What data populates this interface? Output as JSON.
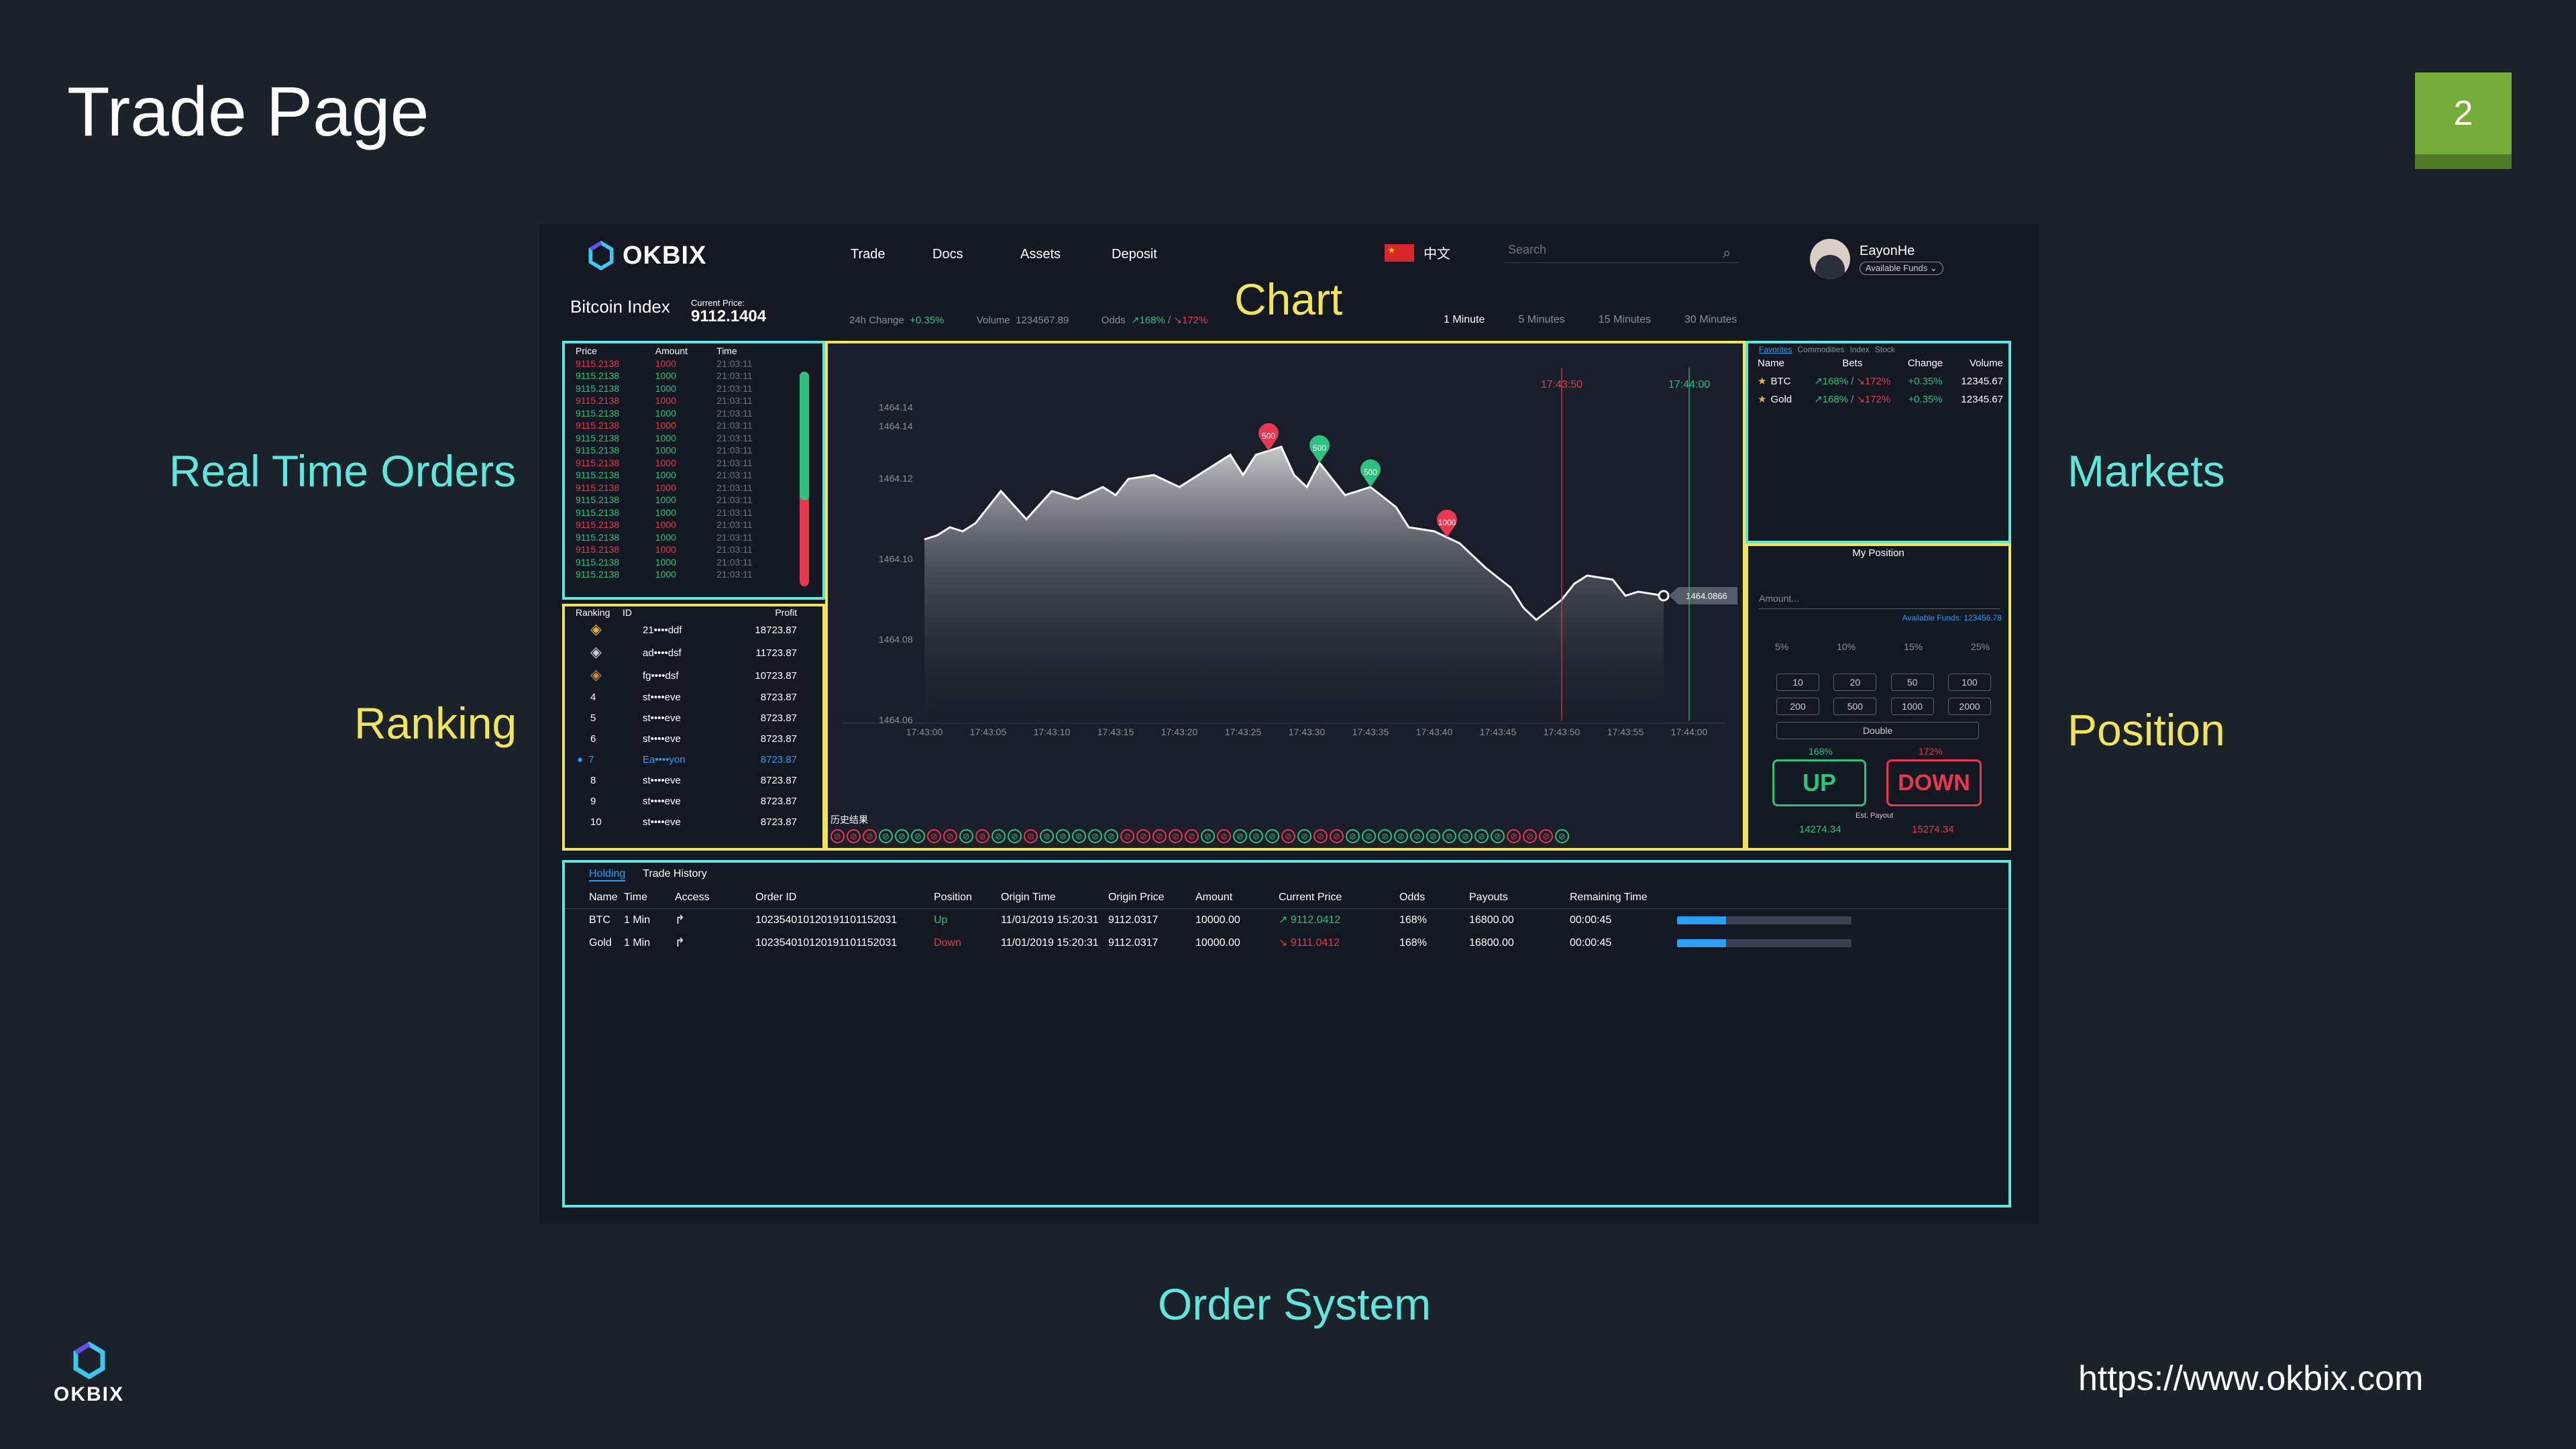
{
  "slide": {
    "title": "Trade Page",
    "page_number": "2",
    "url": "https://www.okbix.com",
    "logo_text": "OKBIX",
    "callouts": {
      "real_time_orders": "Real Time Orders",
      "ranking": "Ranking",
      "chart": "Chart",
      "markets": "Markets",
      "position": "Position",
      "order_system": "Order System"
    }
  },
  "app": {
    "logo": "OKBIX",
    "nav": [
      "Trade",
      "Docs",
      "Assets",
      "Deposit"
    ],
    "language": "中文",
    "search_placeholder": "Search",
    "user_name": "EayonHe",
    "funds_dropdown": "Available Funds",
    "index_name": "Bitcoin Index",
    "current_price_label": "Current Price:",
    "current_price": "9112.1404",
    "change_label": "24h Change",
    "change_value": "+0.35%",
    "volume_label": "Volume",
    "volume_value": "1234567.89",
    "odds_label": "Odds",
    "odds_up": "↗168%",
    "odds_sep": "/",
    "odds_down": "↘172%",
    "timeframes": [
      "1 Minute",
      "5 Minutes",
      "15 Minutes",
      "30 Minutes"
    ],
    "orders": {
      "headers": [
        "Price",
        "Amount",
        "Time"
      ],
      "rows": [
        {
          "price": "9115.2138",
          "amount": "1000",
          "time": "21:03:11",
          "side": "down"
        },
        {
          "price": "9115.2138",
          "amount": "1000",
          "time": "21:03:11",
          "side": "up"
        },
        {
          "price": "9115.2138",
          "amount": "1000",
          "time": "21:03:11",
          "side": "up"
        },
        {
          "price": "9115.2138",
          "amount": "1000",
          "time": "21:03:11",
          "side": "down"
        },
        {
          "price": "9115.2138",
          "amount": "1000",
          "time": "21:03:11",
          "side": "up"
        },
        {
          "price": "9115.2138",
          "amount": "1000",
          "time": "21:03:11",
          "side": "down"
        },
        {
          "price": "9115.2138",
          "amount": "1000",
          "time": "21:03:11",
          "side": "up"
        },
        {
          "price": "9115.2138",
          "amount": "1000",
          "time": "21:03:11",
          "side": "up"
        },
        {
          "price": "9115.2138",
          "amount": "1000",
          "time": "21:03:11",
          "side": "down"
        },
        {
          "price": "9115.2138",
          "amount": "1000",
          "time": "21:03:11",
          "side": "up"
        },
        {
          "price": "9115.2138",
          "amount": "1000",
          "time": "21:03:11",
          "side": "down"
        },
        {
          "price": "9115.2138",
          "amount": "1000",
          "time": "21:03:11",
          "side": "up"
        },
        {
          "price": "9115.2138",
          "amount": "1000",
          "time": "21:03:11",
          "side": "up"
        },
        {
          "price": "9115.2138",
          "amount": "1000",
          "time": "21:03:11",
          "side": "down"
        },
        {
          "price": "9115.2138",
          "amount": "1000",
          "time": "21:03:11",
          "side": "up"
        },
        {
          "price": "9115.2138",
          "amount": "1000",
          "time": "21:03:11",
          "side": "down"
        },
        {
          "price": "9115.2138",
          "amount": "1000",
          "time": "21:03:11",
          "side": "up"
        },
        {
          "price": "9115.2138",
          "amount": "1000",
          "time": "21:03:11",
          "side": "up"
        }
      ],
      "buy_ratio": 0.6
    },
    "ranking": {
      "headers": [
        "Ranking",
        "ID",
        "Profit"
      ],
      "rows": [
        {
          "rank": "",
          "medal": "gold",
          "id": "21••••ddf",
          "profit": "18723.87"
        },
        {
          "rank": "",
          "medal": "silver",
          "id": "ad••••dsf",
          "profit": "11723.87"
        },
        {
          "rank": "",
          "medal": "bronze",
          "id": "fg••••dsf",
          "profit": "10723.87"
        },
        {
          "rank": "4",
          "id": "st••••eve",
          "profit": "8723.87"
        },
        {
          "rank": "5",
          "id": "st••••eve",
          "profit": "8723.87"
        },
        {
          "rank": "6",
          "id": "st••••eve",
          "profit": "8723.87"
        },
        {
          "rank": "7",
          "id": "Ea••••yon",
          "profit": "8723.87",
          "me": true
        },
        {
          "rank": "8",
          "id": "st••••eve",
          "profit": "8723.87"
        },
        {
          "rank": "9",
          "id": "st••••eve",
          "profit": "8723.87"
        },
        {
          "rank": "10",
          "id": "st••••eve",
          "profit": "8723.87"
        }
      ]
    },
    "chart_data": {
      "type": "area",
      "y_ticks": [
        "1464.14",
        "1464.14",
        "1464.12",
        "1464.10",
        "1464.08",
        "1464.06"
      ],
      "x_ticks": [
        "17:43:00",
        "17:43:05",
        "17:43:10",
        "17:43:15",
        "17:43:20",
        "17:43:25",
        "17:43:30",
        "17:43:35",
        "17:43:40",
        "17:43:45",
        "17:43:50",
        "17:43:55",
        "17:44:00"
      ],
      "ylim": [
        1464.06,
        1464.145
      ],
      "series": [
        {
          "x": [
            "17:43:00",
            "17:43:01",
            "17:43:02",
            "17:43:03",
            "17:43:04",
            "17:43:06",
            "17:43:08",
            "17:43:10",
            "17:43:12",
            "17:43:14",
            "17:43:15",
            "17:43:16",
            "17:43:18",
            "17:43:20",
            "17:43:22",
            "17:43:24",
            "17:43:25",
            "17:43:26",
            "17:43:27",
            "17:43:28",
            "17:43:29",
            "17:43:30",
            "17:43:31",
            "17:43:32",
            "17:43:33",
            "17:43:35",
            "17:43:37",
            "17:43:38",
            "17:43:40",
            "17:43:42",
            "17:43:43",
            "17:43:44",
            "17:43:46",
            "17:43:47",
            "17:43:48",
            "17:43:50",
            "17:43:51",
            "17:43:52",
            "17:43:54",
            "17:43:55",
            "17:43:56",
            "17:43:58"
          ],
          "y": [
            1464.105,
            1464.106,
            1464.108,
            1464.107,
            1464.109,
            1464.117,
            1464.11,
            1464.117,
            1464.115,
            1464.118,
            1464.116,
            1464.12,
            1464.121,
            1464.118,
            1464.122,
            1464.126,
            1464.121,
            1464.126,
            1464.127,
            1464.128,
            1464.121,
            1464.118,
            1464.124,
            1464.12,
            1464.116,
            1464.118,
            1464.113,
            1464.108,
            1464.107,
            1464.104,
            1464.101,
            1464.098,
            1464.093,
            1464.088,
            1464.085,
            1464.09,
            1464.094,
            1464.096,
            1464.095,
            1464.091,
            1464.092,
            1464.091
          ]
        }
      ],
      "bet_markers": [
        {
          "x": "17:43:27",
          "label": "500",
          "side": "down"
        },
        {
          "x": "17:43:31",
          "label": "500",
          "side": "up"
        },
        {
          "x": "17:43:35",
          "label": "500",
          "side": "up"
        },
        {
          "x": "17:43:41",
          "label": "1000",
          "side": "down"
        }
      ],
      "vertical_lines": [
        {
          "x": "17:43:50",
          "label": "17:43:50",
          "color": "#e8384f"
        },
        {
          "x": "17:44:00",
          "label": "17:44:00",
          "color": "#2ec27e"
        }
      ],
      "current_value_label": "1464.0866",
      "history_label": "历史结果",
      "history": [
        "d",
        "d",
        "d",
        "u",
        "u",
        "u",
        "d",
        "d",
        "u",
        "d",
        "u",
        "u",
        "d",
        "u",
        "u",
        "u",
        "u",
        "u",
        "d",
        "d",
        "d",
        "d",
        "d",
        "u",
        "d",
        "u",
        "u",
        "u",
        "d",
        "u",
        "d",
        "d",
        "u",
        "u",
        "u",
        "u",
        "u",
        "u",
        "u",
        "u",
        "u",
        "u",
        "d",
        "d",
        "d",
        "u"
      ]
    },
    "markets": {
      "tabs": [
        "Favorites",
        "Commodities",
        "Index",
        "Stock"
      ],
      "headers": [
        "Name",
        "Bets",
        "Change",
        "Volume"
      ],
      "rows": [
        {
          "name": "BTC",
          "bets_up": "↗168%",
          "sep": "/",
          "bets_down": "↘172%",
          "change": "+0.35%",
          "volume": "12345.67"
        },
        {
          "name": "Gold",
          "bets_up": "↗168%",
          "sep": "/",
          "bets_down": "↘172%",
          "change": "+0.35%",
          "volume": "12345.67"
        }
      ]
    },
    "position": {
      "title": "My Position",
      "amount_placeholder": "Amount...",
      "available_funds": "Available Funds: 123456.78",
      "percents": [
        "5%",
        "10%",
        "15%",
        "25%"
      ],
      "amounts_row1": [
        "10",
        "20",
        "50",
        "100"
      ],
      "amounts_row2": [
        "200",
        "500",
        "1000",
        "2000"
      ],
      "double_label": "Double",
      "up_odds": "168%",
      "down_odds": "172%",
      "up_label": "UP",
      "down_label": "DOWN",
      "est_payout_label": "Est. Payout",
      "up_payout": "14274.34",
      "down_payout": "15274.34"
    },
    "holding": {
      "tabs": [
        "Holding",
        "Trade History"
      ],
      "headers": [
        "Name",
        "Time",
        "Access",
        "Order ID",
        "Position",
        "Origin Time",
        "Origin Price",
        "Amount",
        "Current Price",
        "Odds",
        "Payouts",
        "Remaining Time"
      ],
      "rows": [
        {
          "name": "BTC",
          "time": "1 Min",
          "order_id": "102354010120191101152031",
          "position": "Up",
          "origin_time": "11/01/2019   15:20:31",
          "origin_price": "9112.0317",
          "amount": "10000.00",
          "current_price": "↗ 9112.0412",
          "odds": "168%",
          "payouts": "16800.00",
          "remaining": "00:00:45",
          "progress": 0.28
        },
        {
          "name": "Gold",
          "time": "1 Min",
          "order_id": "102354010120191101152031",
          "position": "Down",
          "origin_time": "11/01/2019   15:20:31",
          "origin_price": "9112.0317",
          "amount": "10000.00",
          "current_price": "↘ 9111.0412",
          "odds": "168%",
          "payouts": "16800.00",
          "remaining": "00:00:45",
          "progress": 0.28
        }
      ]
    }
  },
  "colors": {
    "cyan": "#5fe6dd",
    "yellow": "#f0e55a",
    "up": "#2ec27e",
    "down": "#e8384f",
    "accent": "#76ac3a"
  }
}
